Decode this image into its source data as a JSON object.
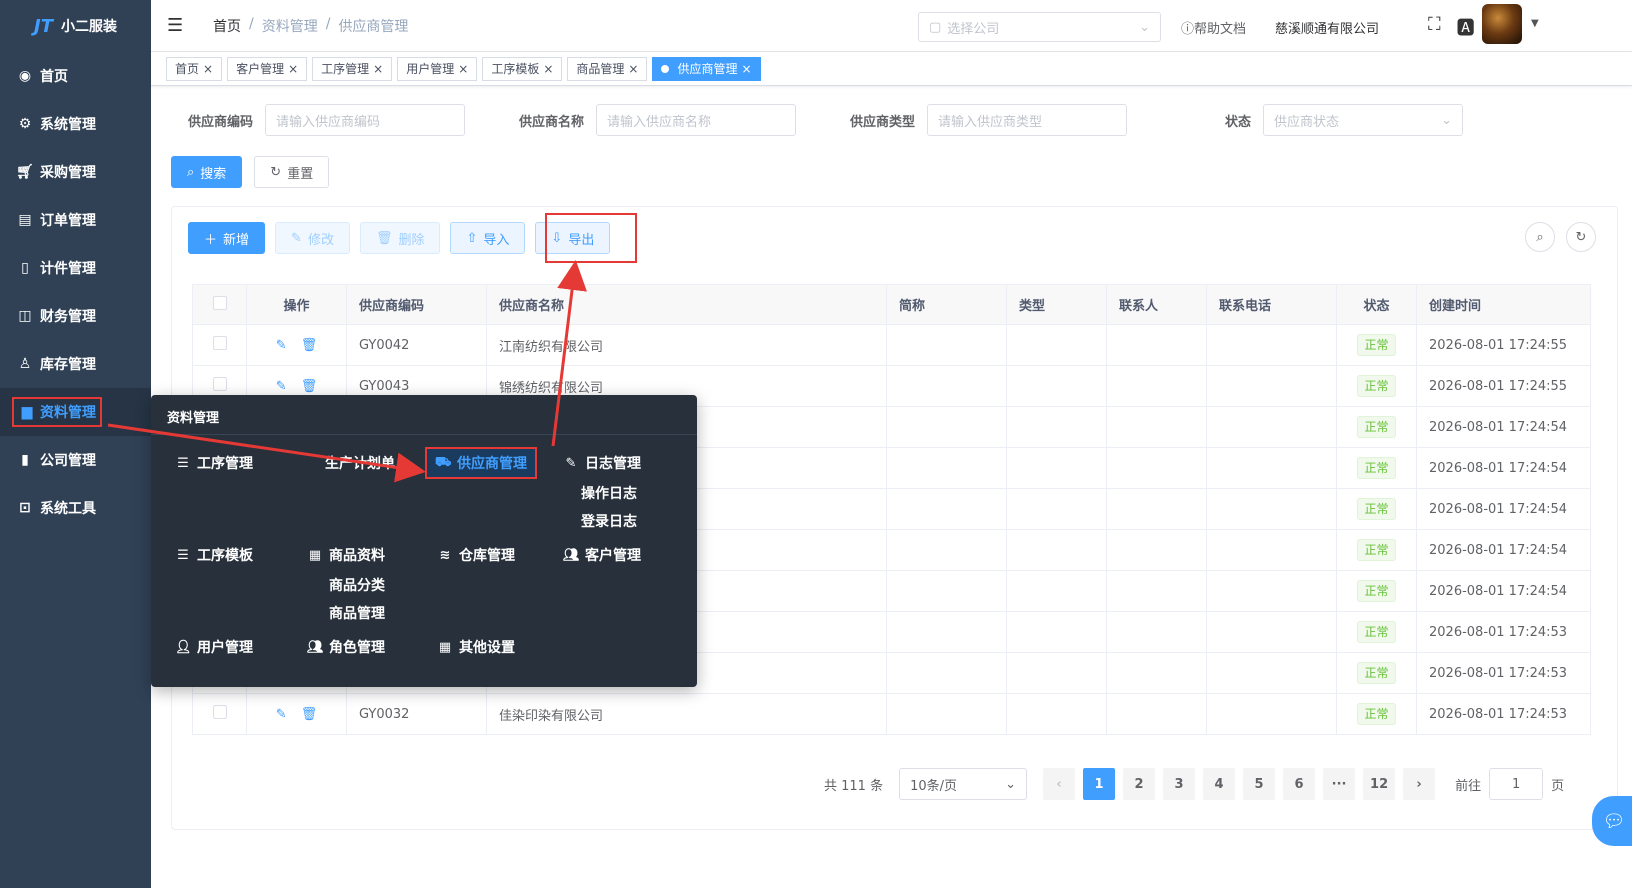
{
  "app": {
    "logo_mark": "JT",
    "logo_text": "小二服装"
  },
  "sidebar": {
    "items": [
      {
        "label": "首页",
        "icon": "dashboard-icon"
      },
      {
        "label": "系统管理",
        "icon": "gear-icon"
      },
      {
        "label": "采购管理",
        "icon": "cart-icon"
      },
      {
        "label": "订单管理",
        "icon": "order-icon"
      },
      {
        "label": "计件管理",
        "icon": "book-icon"
      },
      {
        "label": "财务管理",
        "icon": "chart-icon"
      },
      {
        "label": "库存管理",
        "icon": "user-icon"
      },
      {
        "label": "资料管理",
        "icon": "document-icon",
        "active": true
      },
      {
        "label": "公司管理",
        "icon": "bar-chart-icon"
      },
      {
        "label": "系统工具",
        "icon": "toolbox-icon"
      }
    ]
  },
  "navbar": {
    "breadcrumb": [
      "首页",
      "资料管理",
      "供应商管理"
    ],
    "company_placeholder": "选择公司",
    "help": "帮助文档",
    "company_name": "慈溪顺通有限公司"
  },
  "tags": [
    "首页",
    "客户管理",
    "工序管理",
    "用户管理",
    "工序模板",
    "商品管理",
    "供应商管理"
  ],
  "search": {
    "code_label": "供应商编码",
    "code_placeholder": "请输入供应商编码",
    "name_label": "供应商名称",
    "name_placeholder": "请输入供应商名称",
    "type_label": "供应商类型",
    "type_placeholder": "请输入供应商类型",
    "status_label": "状态",
    "status_placeholder": "供应商状态",
    "search_btn": "搜索",
    "reset_btn": "重置"
  },
  "toolbar": {
    "add": "新增",
    "edit": "修改",
    "delete": "删除",
    "import": "导入",
    "export": "导出"
  },
  "table": {
    "headers": [
      "操作",
      "供应商编码",
      "供应商名称",
      "简称",
      "类型",
      "联系人",
      "联系电话",
      "状态",
      "创建时间"
    ],
    "rows": [
      {
        "code": "GY0042",
        "name": "江南纺织有限公司",
        "status": "正常",
        "created": "2026-08-01 17:24:55"
      },
      {
        "code": "GY0043",
        "name": "锦绣纺织有限公司",
        "status": "正常",
        "created": "2026-08-01 17:24:55"
      },
      {
        "code": "",
        "name": "",
        "status": "正常",
        "created": "2026-08-01 17:24:54"
      },
      {
        "code": "",
        "name": "",
        "status": "正常",
        "created": "2026-08-01 17:24:54"
      },
      {
        "code": "",
        "name": "",
        "status": "正常",
        "created": "2026-08-01 17:24:54"
      },
      {
        "code": "",
        "name": "",
        "status": "正常",
        "created": "2026-08-01 17:24:54"
      },
      {
        "code": "",
        "name": "",
        "status": "正常",
        "created": "2026-08-01 17:24:54"
      },
      {
        "code": "",
        "name": "",
        "status": "正常",
        "created": "2026-08-01 17:24:53"
      },
      {
        "code": "",
        "name": "",
        "status": "正常",
        "created": "2026-08-01 17:24:53"
      },
      {
        "code": "GY0032",
        "name": "佳染印染有限公司",
        "status": "正常",
        "created": "2026-08-01 17:24:53"
      }
    ]
  },
  "pagination": {
    "total": "共 111 条",
    "page_size": "10条/页",
    "pages": [
      "1",
      "2",
      "3",
      "4",
      "5",
      "6",
      "···",
      "12"
    ],
    "goto_label": "前往",
    "goto_value": "1",
    "page_unit": "页"
  },
  "popup": {
    "title": "资料管理",
    "items": {
      "process": "工序管理",
      "production": "生产计划单",
      "supplier": "供应商管理",
      "log": "日志管理",
      "op_log": "操作日志",
      "login_log": "登录日志",
      "template": "工序模板",
      "goods": "商品资料",
      "warehouse": "仓库管理",
      "customer": "客户管理",
      "goods_cat": "商品分类",
      "goods_mgmt": "商品管理",
      "users": "用户管理",
      "roles": "角色管理",
      "other": "其他设置"
    }
  },
  "colors": {
    "primary": "#409eff",
    "sidebar": "#304156",
    "annotation": "#e53935",
    "success": "#67c23a"
  }
}
